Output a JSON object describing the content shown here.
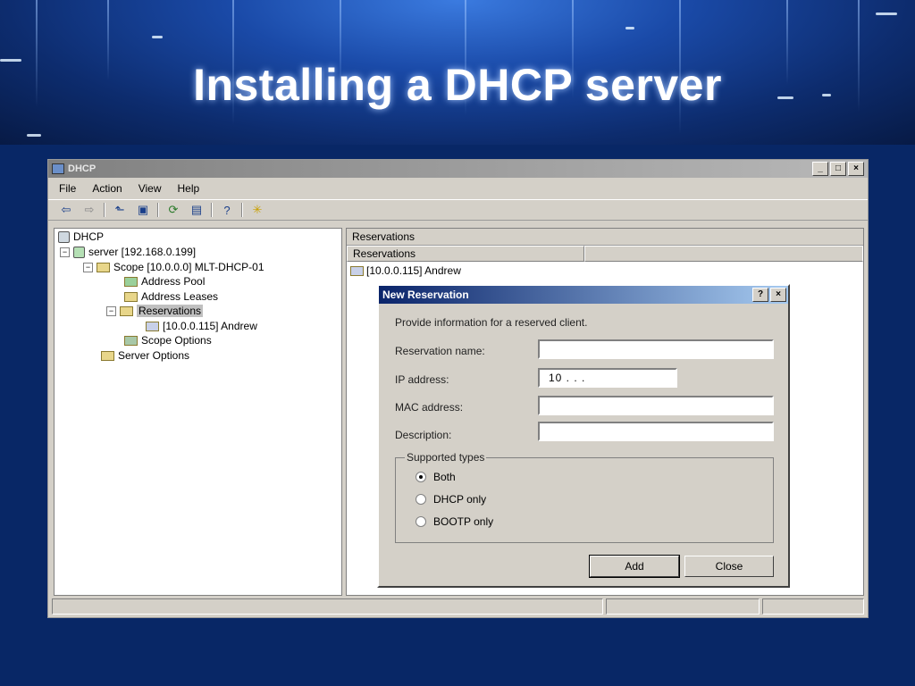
{
  "slide": {
    "title": "Installing a DHCP server"
  },
  "window": {
    "title": "DHCP",
    "controls": [
      "_",
      "□",
      "×"
    ],
    "menu": [
      "File",
      "Action",
      "View",
      "Help"
    ],
    "toolbar_icons": [
      "back-arrow-icon",
      "forward-arrow-icon",
      "up-folder-icon",
      "show-tree-icon",
      "refresh-icon",
      "export-list-icon",
      "help-icon",
      "star-icon"
    ]
  },
  "tree": {
    "root": "DHCP",
    "server": "server [192.168.0.199]",
    "scope": "Scope [10.0.0.0] MLT-DHCP-01",
    "address_pool": "Address Pool",
    "address_leases": "Address Leases",
    "reservations": "Reservations",
    "reservation_item": "[10.0.0.115] Andrew",
    "scope_options": "Scope Options",
    "server_options": "Server Options"
  },
  "right_pane": {
    "header": "Reservations",
    "column": "Reservations",
    "item": "[10.0.0.115] Andrew"
  },
  "dialog": {
    "title": "New Reservation",
    "title_buttons": [
      "?",
      "×"
    ],
    "intro": "Provide information for a reserved client.",
    "reservation_name_label": "Reservation name:",
    "reservation_name_value": "",
    "ip_label": "IP address:",
    "ip_value": "10 .       .       .",
    "mac_label": "MAC address:",
    "mac_value": "",
    "description_label": "Description:",
    "description_value": "",
    "group_label": "Supported types",
    "options": [
      "Both",
      "DHCP only",
      "BOOTP only"
    ],
    "selected_option": "Both",
    "add_label": "Add",
    "close_label": "Close"
  }
}
